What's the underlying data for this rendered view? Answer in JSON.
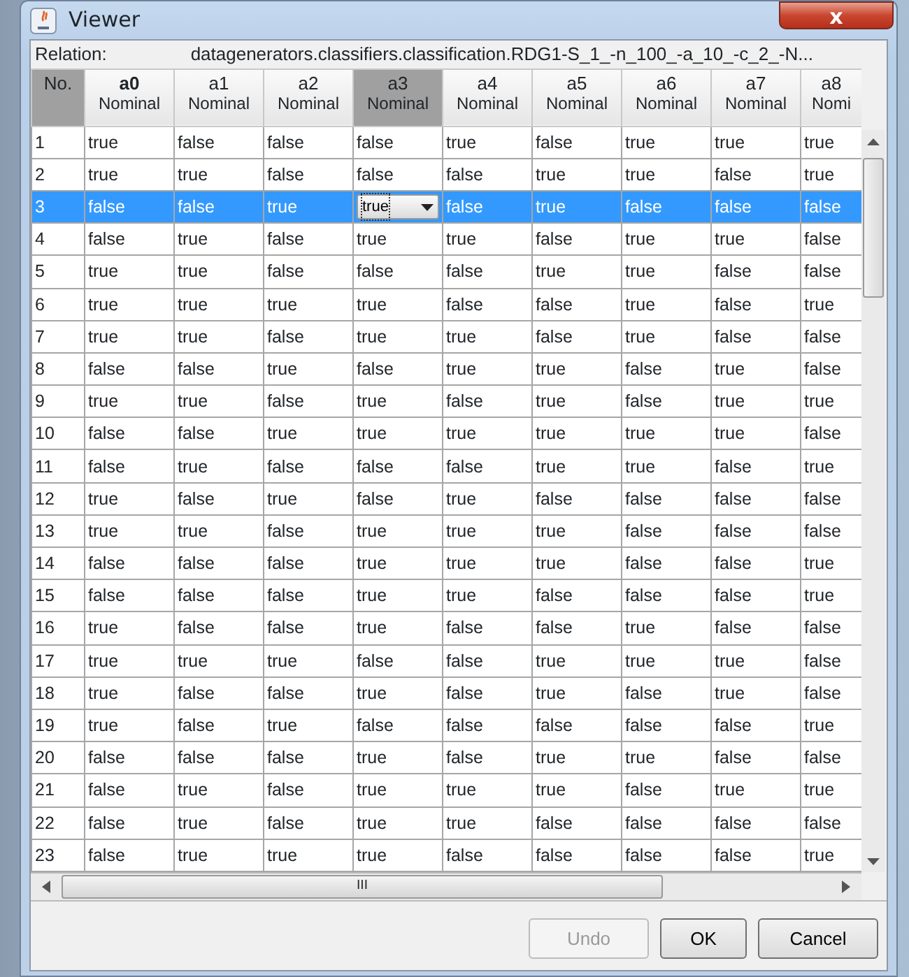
{
  "window": {
    "title": "Viewer",
    "close": "x"
  },
  "relation": {
    "label": "Relation:",
    "value": "datagenerators.classifiers.classification.RDG1-S_1_-n_100_-a_10_-c_2_-N..."
  },
  "table": {
    "columns": [
      {
        "name": "No.",
        "kind": "index",
        "class_attribute": false,
        "selected": true
      },
      {
        "name": "a0",
        "type": "Nominal",
        "kind": "attribute",
        "class_attribute": true,
        "selected": false
      },
      {
        "name": "a1",
        "type": "Nominal",
        "kind": "attribute",
        "class_attribute": false,
        "selected": false
      },
      {
        "name": "a2",
        "type": "Nominal",
        "kind": "attribute",
        "class_attribute": false,
        "selected": false
      },
      {
        "name": "a3",
        "type": "Nominal",
        "kind": "attribute",
        "class_attribute": false,
        "selected": true
      },
      {
        "name": "a4",
        "type": "Nominal",
        "kind": "attribute",
        "class_attribute": false,
        "selected": false
      },
      {
        "name": "a5",
        "type": "Nominal",
        "kind": "attribute",
        "class_attribute": false,
        "selected": false
      },
      {
        "name": "a6",
        "type": "Nominal",
        "kind": "attribute",
        "class_attribute": false,
        "selected": false
      },
      {
        "name": "a7",
        "type": "Nominal",
        "kind": "attribute",
        "class_attribute": false,
        "selected": false
      },
      {
        "name": "a8",
        "type": "Nomi",
        "kind": "cut",
        "class_attribute": false,
        "selected": false
      }
    ],
    "rows": [
      {
        "selected": false,
        "cells": [
          "1",
          "true",
          "false",
          "false",
          "false",
          "true",
          "false",
          "true",
          "true",
          "true"
        ]
      },
      {
        "selected": false,
        "cells": [
          "2",
          "true",
          "true",
          "false",
          "false",
          "false",
          "true",
          "true",
          "false",
          "true"
        ]
      },
      {
        "selected": true,
        "cells": [
          "3",
          "false",
          "false",
          "true",
          "true",
          "false",
          "true",
          "false",
          "false",
          "false"
        ]
      },
      {
        "selected": false,
        "cells": [
          "4",
          "false",
          "true",
          "false",
          "true",
          "true",
          "false",
          "true",
          "true",
          "false"
        ]
      },
      {
        "selected": false,
        "cells": [
          "5",
          "true",
          "true",
          "false",
          "false",
          "false",
          "true",
          "true",
          "false",
          "false"
        ]
      },
      {
        "selected": false,
        "cells": [
          "6",
          "true",
          "true",
          "true",
          "true",
          "false",
          "false",
          "true",
          "false",
          "true"
        ]
      },
      {
        "selected": false,
        "cells": [
          "7",
          "true",
          "true",
          "false",
          "true",
          "true",
          "false",
          "true",
          "false",
          "false"
        ]
      },
      {
        "selected": false,
        "cells": [
          "8",
          "false",
          "false",
          "true",
          "false",
          "true",
          "true",
          "false",
          "true",
          "false"
        ]
      },
      {
        "selected": false,
        "cells": [
          "9",
          "true",
          "true",
          "false",
          "true",
          "false",
          "true",
          "false",
          "true",
          "true"
        ]
      },
      {
        "selected": false,
        "cells": [
          "10",
          "false",
          "false",
          "true",
          "true",
          "true",
          "true",
          "true",
          "true",
          "false"
        ]
      },
      {
        "selected": false,
        "cells": [
          "11",
          "false",
          "true",
          "false",
          "false",
          "false",
          "true",
          "true",
          "false",
          "true"
        ]
      },
      {
        "selected": false,
        "cells": [
          "12",
          "true",
          "false",
          "true",
          "false",
          "true",
          "false",
          "false",
          "false",
          "false"
        ]
      },
      {
        "selected": false,
        "cells": [
          "13",
          "true",
          "true",
          "false",
          "true",
          "true",
          "true",
          "false",
          "false",
          "false"
        ]
      },
      {
        "selected": false,
        "cells": [
          "14",
          "false",
          "false",
          "false",
          "true",
          "true",
          "true",
          "false",
          "false",
          "true"
        ]
      },
      {
        "selected": false,
        "cells": [
          "15",
          "false",
          "false",
          "false",
          "true",
          "true",
          "false",
          "false",
          "false",
          "true"
        ]
      },
      {
        "selected": false,
        "cells": [
          "16",
          "true",
          "false",
          "false",
          "true",
          "false",
          "false",
          "true",
          "false",
          "false"
        ]
      },
      {
        "selected": false,
        "cells": [
          "17",
          "true",
          "true",
          "true",
          "false",
          "false",
          "true",
          "true",
          "true",
          "false"
        ]
      },
      {
        "selected": false,
        "cells": [
          "18",
          "true",
          "false",
          "false",
          "true",
          "false",
          "true",
          "false",
          "true",
          "false"
        ]
      },
      {
        "selected": false,
        "cells": [
          "19",
          "true",
          "false",
          "true",
          "false",
          "false",
          "false",
          "false",
          "false",
          "true"
        ]
      },
      {
        "selected": false,
        "cells": [
          "20",
          "false",
          "false",
          "false",
          "true",
          "false",
          "true",
          "true",
          "false",
          "false"
        ]
      },
      {
        "selected": false,
        "cells": [
          "21",
          "false",
          "true",
          "false",
          "true",
          "true",
          "true",
          "false",
          "true",
          "true"
        ]
      },
      {
        "selected": false,
        "cells": [
          "22",
          "false",
          "true",
          "false",
          "true",
          "true",
          "false",
          "false",
          "false",
          "false"
        ]
      },
      {
        "selected": false,
        "cells": [
          "23",
          "false",
          "true",
          "true",
          "true",
          "false",
          "false",
          "false",
          "false",
          "true"
        ]
      }
    ]
  },
  "scrollbar": {
    "grip": "III"
  },
  "buttons": [
    {
      "label": "Undo",
      "disabled": true
    },
    {
      "label": "OK",
      "disabled": false
    },
    {
      "label": "Cancel",
      "disabled": false
    }
  ]
}
